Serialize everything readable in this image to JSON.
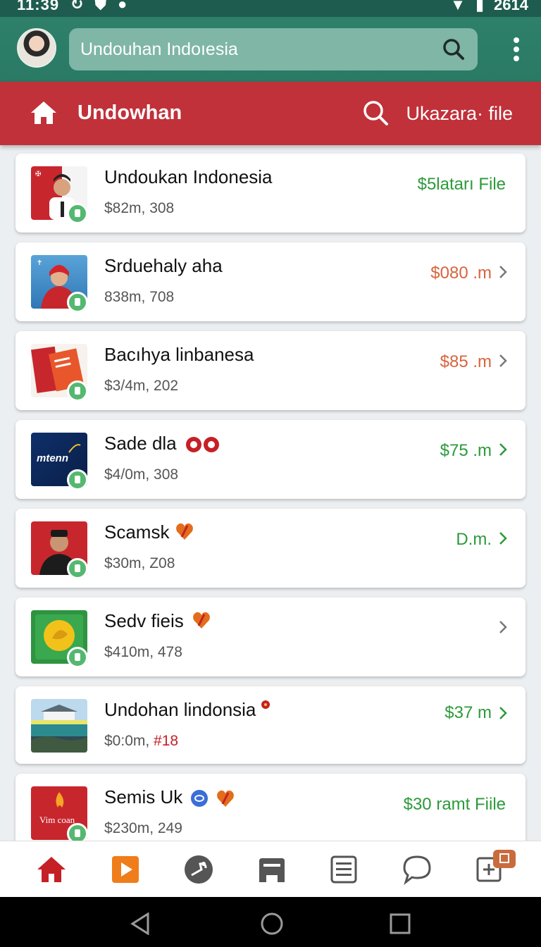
{
  "status_bar": {
    "time": "11:39",
    "right_text": "2614",
    "left_icons": [
      "sync-icon",
      "shield-icon",
      "circle-icon"
    ],
    "right_icons": [
      "wifi-icon",
      "battery-icon"
    ]
  },
  "top_bar": {
    "search_text": "Undouhan Indoıesia",
    "icons": [
      "avatar",
      "search-icon",
      "more-vert-icon"
    ]
  },
  "toolbar": {
    "title": "Undowhan",
    "action_label": "Ukazara· file",
    "icons": [
      "home-icon",
      "search-icon"
    ]
  },
  "items": [
    {
      "name": "Undoukan Indonesia",
      "meta": "$82m, 308",
      "price": "$5latarı File",
      "price_color": "#2b9a3a",
      "chevron": false
    },
    {
      "name": "Srduehaly aha",
      "meta": "838m, 708",
      "price": "$080 .m",
      "price_color": "#d7643d",
      "chevron": true
    },
    {
      "name": "Bacıhya linbanesa",
      "meta": "$3/4m, 202",
      "price": "$85 .m",
      "price_color": "#d7643d",
      "chevron": true
    },
    {
      "name": "Sade dla",
      "meta": "$4/0m, 308",
      "price": "$75 .m",
      "price_color": "#2b9a3a",
      "chevron": true
    },
    {
      "name": "Scamsk",
      "meta": "$30m, Z08",
      "price": "D.m.",
      "price_color": "#2b9a3a",
      "chevron": true
    },
    {
      "name": "Sedv fieis",
      "meta": "$410m, 478",
      "price": "",
      "price_color": "#2b9a3a",
      "chevron": true
    },
    {
      "name": "Undohan lindonsia",
      "meta_prefix": "$0:0m, ",
      "meta_highlight": "#18",
      "price": "$37 m",
      "price_color": "#2b9a3a",
      "chevron": true
    },
    {
      "name": "Semis Uk",
      "meta": "$230m, 249",
      "price": "$30 ramt Fiile",
      "price_color": "#2b9a3a",
      "chevron": false
    }
  ],
  "thumb_texts": {
    "item_4": "mtenn",
    "item_8_line1": "Vim coan"
  },
  "bottom_nav": [
    "home-icon",
    "play-icon",
    "explore-icon",
    "inbox-icon",
    "list-icon",
    "chat-icon",
    "add-icon"
  ],
  "system_nav": [
    "back-icon",
    "home-circle-icon",
    "recents-icon"
  ],
  "colors": {
    "app_bar": "#2a7a64",
    "toolbar_red": "#c1313a",
    "price_green": "#2b9a3a",
    "price_orange": "#d7643d"
  }
}
